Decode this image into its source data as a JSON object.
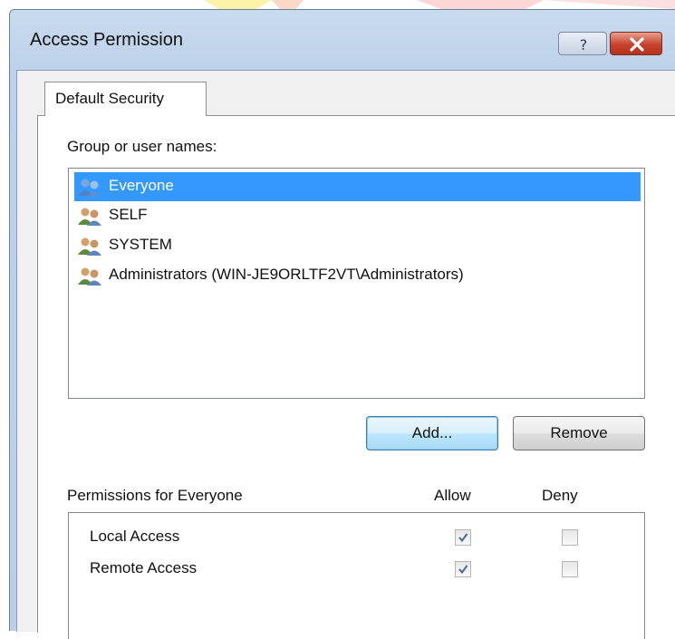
{
  "window": {
    "title": "Access Permission",
    "help_icon": "help-question-icon",
    "close_icon": "close-x-icon"
  },
  "tabs": [
    {
      "label": "Default Security",
      "active": true
    }
  ],
  "users": {
    "label": "Group or user names:",
    "items": [
      {
        "name": "Everyone",
        "icon": "user-group-icon",
        "selected": true
      },
      {
        "name": "SELF",
        "icon": "user-group-icon",
        "selected": false
      },
      {
        "name": "SYSTEM",
        "icon": "user-group-icon",
        "selected": false
      },
      {
        "name": "Administrators (WIN-JE9ORLTF2VT\\Administrators)",
        "icon": "user-group-icon",
        "selected": false
      }
    ],
    "add_label": "Add...",
    "remove_label": "Remove"
  },
  "permissions": {
    "label": "Permissions for Everyone",
    "allow_header": "Allow",
    "deny_header": "Deny",
    "rows": [
      {
        "name": "Local Access",
        "allow": true,
        "deny": false
      },
      {
        "name": "Remote Access",
        "allow": true,
        "deny": false
      }
    ]
  },
  "colors": {
    "selection": "#3399ff",
    "dialog_frame": "#bed2ea",
    "close_button": "#c7432c"
  }
}
